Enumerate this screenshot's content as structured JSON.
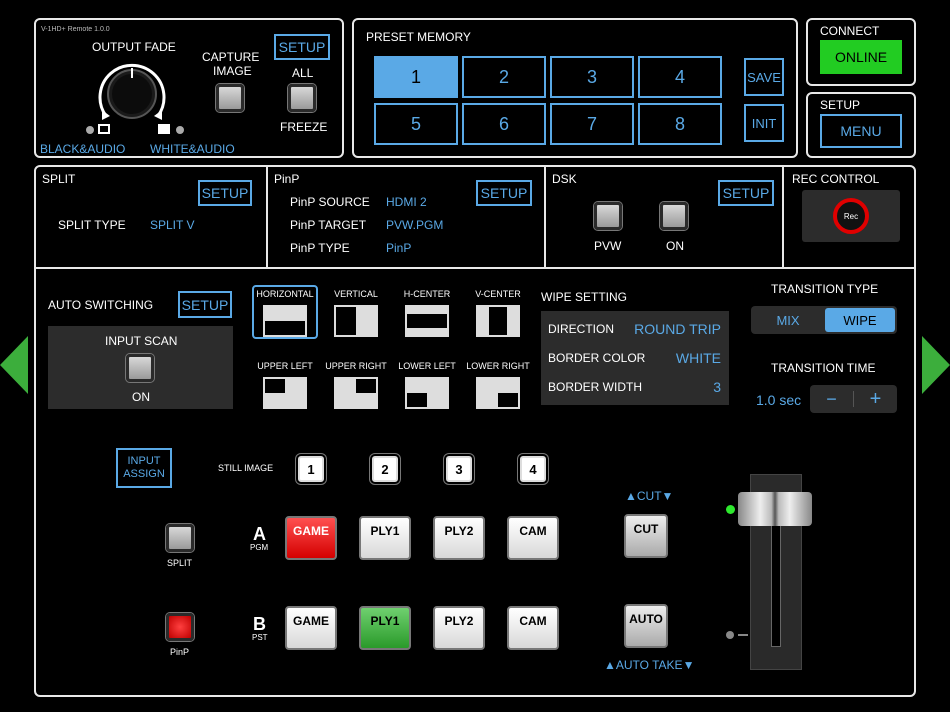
{
  "version": "V-1HD+ Remote 1.0.0",
  "output_fade": {
    "title": "OUTPUT FADE",
    "left_label": "BLACK&AUDIO",
    "right_label": "WHITE&AUDIO"
  },
  "capture": {
    "label_line1": "CAPTURE",
    "label_line2": "IMAGE",
    "setup": "SETUP",
    "all": "ALL",
    "freeze": "FREEZE"
  },
  "preset": {
    "title": "PRESET MEMORY",
    "buttons": [
      "1",
      "2",
      "3",
      "4",
      "5",
      "6",
      "7",
      "8"
    ],
    "selected": "1",
    "save": "SAVE",
    "init": "INIT"
  },
  "connect": {
    "title": "CONNECT",
    "status": "ONLINE"
  },
  "setup_menu": {
    "title": "SETUP",
    "menu": "MENU"
  },
  "split": {
    "title": "SPLIT",
    "setup": "SETUP",
    "type_label": "SPLIT TYPE",
    "type_value": "SPLIT V"
  },
  "pinp": {
    "title": "PinP",
    "setup": "SETUP",
    "rows": [
      {
        "label": "PinP SOURCE",
        "value": "HDMI 2"
      },
      {
        "label": "PinP TARGET",
        "value": "PVW.PGM"
      },
      {
        "label": "PinP TYPE",
        "value": "PinP"
      }
    ]
  },
  "dsk": {
    "title": "DSK",
    "setup": "SETUP",
    "pvw": "PVW",
    "on": "ON"
  },
  "rec": {
    "title": "REC CONTROL",
    "button": "Rec"
  },
  "auto_switching": {
    "title": "AUTO SWITCHING",
    "setup": "SETUP",
    "input_scan": "INPUT SCAN",
    "on": "ON"
  },
  "wipe_patterns": [
    "HORIZONTAL",
    "VERTICAL",
    "H-CENTER",
    "V-CENTER",
    "UPPER LEFT",
    "UPPER RIGHT",
    "LOWER LEFT",
    "LOWER RIGHT"
  ],
  "wipe_setting": {
    "title": "WIPE SETTING",
    "rows": [
      {
        "label": "DIRECTION",
        "value": "ROUND TRIP"
      },
      {
        "label": "BORDER COLOR",
        "value": "WHITE"
      },
      {
        "label": "BORDER WIDTH",
        "value": "3"
      }
    ]
  },
  "transition": {
    "type_title": "TRANSITION TYPE",
    "mix": "MIX",
    "wipe": "WIPE",
    "selected": "WIPE",
    "time_title": "TRANSITION TIME",
    "time_value": "1.0 sec",
    "minus": "−",
    "plus": "+"
  },
  "input_assign": {
    "line1": "INPUT",
    "line2": "ASSIGN"
  },
  "still_image": {
    "label": "STILL IMAGE",
    "numbers": [
      "1",
      "2",
      "3",
      "4"
    ]
  },
  "bus_a": {
    "letter": "A",
    "sub": "PGM",
    "buttons": [
      "GAME",
      "PLY1",
      "PLY2",
      "CAM"
    ]
  },
  "bus_b": {
    "letter": "B",
    "sub": "PST",
    "buttons": [
      "GAME",
      "PLY1",
      "PLY2",
      "CAM"
    ]
  },
  "split_btn": "SPLIT",
  "pinp_btn": "PinP",
  "cut": {
    "label_top": "▲CUT▼",
    "button": "CUT"
  },
  "auto": {
    "button": "AUTO",
    "label_bottom": "▲AUTO TAKE▼"
  },
  "colors": {
    "accent": "#5aa9e6",
    "online": "#22cc22",
    "selected": "#5aa9e6",
    "red": "#e00000",
    "green": "#3cae3c"
  },
  "tbar_level": 0
}
